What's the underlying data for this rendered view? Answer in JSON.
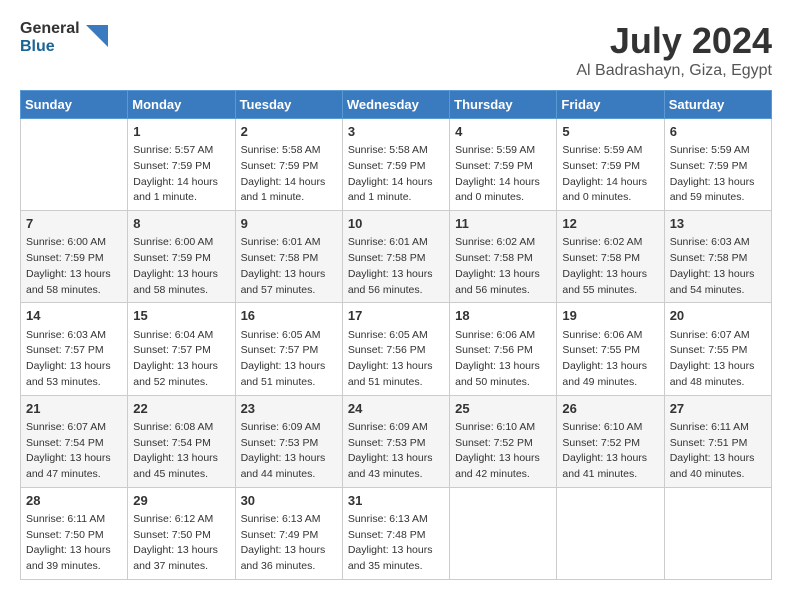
{
  "header": {
    "logo_line1": "General",
    "logo_line2": "Blue",
    "title": "July 2024",
    "subtitle": "Al Badrashayn, Giza, Egypt"
  },
  "weekdays": [
    "Sunday",
    "Monday",
    "Tuesday",
    "Wednesday",
    "Thursday",
    "Friday",
    "Saturday"
  ],
  "weeks": [
    [
      {
        "date": "",
        "content": ""
      },
      {
        "date": "1",
        "content": "Sunrise: 5:57 AM\nSunset: 7:59 PM\nDaylight: 14 hours\nand 1 minute."
      },
      {
        "date": "2",
        "content": "Sunrise: 5:58 AM\nSunset: 7:59 PM\nDaylight: 14 hours\nand 1 minute."
      },
      {
        "date": "3",
        "content": "Sunrise: 5:58 AM\nSunset: 7:59 PM\nDaylight: 14 hours\nand 1 minute."
      },
      {
        "date": "4",
        "content": "Sunrise: 5:59 AM\nSunset: 7:59 PM\nDaylight: 14 hours\nand 0 minutes."
      },
      {
        "date": "5",
        "content": "Sunrise: 5:59 AM\nSunset: 7:59 PM\nDaylight: 14 hours\nand 0 minutes."
      },
      {
        "date": "6",
        "content": "Sunrise: 5:59 AM\nSunset: 7:59 PM\nDaylight: 13 hours\nand 59 minutes."
      }
    ],
    [
      {
        "date": "7",
        "content": "Sunrise: 6:00 AM\nSunset: 7:59 PM\nDaylight: 13 hours\nand 58 minutes."
      },
      {
        "date": "8",
        "content": "Sunrise: 6:00 AM\nSunset: 7:59 PM\nDaylight: 13 hours\nand 58 minutes."
      },
      {
        "date": "9",
        "content": "Sunrise: 6:01 AM\nSunset: 7:58 PM\nDaylight: 13 hours\nand 57 minutes."
      },
      {
        "date": "10",
        "content": "Sunrise: 6:01 AM\nSunset: 7:58 PM\nDaylight: 13 hours\nand 56 minutes."
      },
      {
        "date": "11",
        "content": "Sunrise: 6:02 AM\nSunset: 7:58 PM\nDaylight: 13 hours\nand 56 minutes."
      },
      {
        "date": "12",
        "content": "Sunrise: 6:02 AM\nSunset: 7:58 PM\nDaylight: 13 hours\nand 55 minutes."
      },
      {
        "date": "13",
        "content": "Sunrise: 6:03 AM\nSunset: 7:58 PM\nDaylight: 13 hours\nand 54 minutes."
      }
    ],
    [
      {
        "date": "14",
        "content": "Sunrise: 6:03 AM\nSunset: 7:57 PM\nDaylight: 13 hours\nand 53 minutes."
      },
      {
        "date": "15",
        "content": "Sunrise: 6:04 AM\nSunset: 7:57 PM\nDaylight: 13 hours\nand 52 minutes."
      },
      {
        "date": "16",
        "content": "Sunrise: 6:05 AM\nSunset: 7:57 PM\nDaylight: 13 hours\nand 51 minutes."
      },
      {
        "date": "17",
        "content": "Sunrise: 6:05 AM\nSunset: 7:56 PM\nDaylight: 13 hours\nand 51 minutes."
      },
      {
        "date": "18",
        "content": "Sunrise: 6:06 AM\nSunset: 7:56 PM\nDaylight: 13 hours\nand 50 minutes."
      },
      {
        "date": "19",
        "content": "Sunrise: 6:06 AM\nSunset: 7:55 PM\nDaylight: 13 hours\nand 49 minutes."
      },
      {
        "date": "20",
        "content": "Sunrise: 6:07 AM\nSunset: 7:55 PM\nDaylight: 13 hours\nand 48 minutes."
      }
    ],
    [
      {
        "date": "21",
        "content": "Sunrise: 6:07 AM\nSunset: 7:54 PM\nDaylight: 13 hours\nand 47 minutes."
      },
      {
        "date": "22",
        "content": "Sunrise: 6:08 AM\nSunset: 7:54 PM\nDaylight: 13 hours\nand 45 minutes."
      },
      {
        "date": "23",
        "content": "Sunrise: 6:09 AM\nSunset: 7:53 PM\nDaylight: 13 hours\nand 44 minutes."
      },
      {
        "date": "24",
        "content": "Sunrise: 6:09 AM\nSunset: 7:53 PM\nDaylight: 13 hours\nand 43 minutes."
      },
      {
        "date": "25",
        "content": "Sunrise: 6:10 AM\nSunset: 7:52 PM\nDaylight: 13 hours\nand 42 minutes."
      },
      {
        "date": "26",
        "content": "Sunrise: 6:10 AM\nSunset: 7:52 PM\nDaylight: 13 hours\nand 41 minutes."
      },
      {
        "date": "27",
        "content": "Sunrise: 6:11 AM\nSunset: 7:51 PM\nDaylight: 13 hours\nand 40 minutes."
      }
    ],
    [
      {
        "date": "28",
        "content": "Sunrise: 6:11 AM\nSunset: 7:50 PM\nDaylight: 13 hours\nand 39 minutes."
      },
      {
        "date": "29",
        "content": "Sunrise: 6:12 AM\nSunset: 7:50 PM\nDaylight: 13 hours\nand 37 minutes."
      },
      {
        "date": "30",
        "content": "Sunrise: 6:13 AM\nSunset: 7:49 PM\nDaylight: 13 hours\nand 36 minutes."
      },
      {
        "date": "31",
        "content": "Sunrise: 6:13 AM\nSunset: 7:48 PM\nDaylight: 13 hours\nand 35 minutes."
      },
      {
        "date": "",
        "content": ""
      },
      {
        "date": "",
        "content": ""
      },
      {
        "date": "",
        "content": ""
      }
    ]
  ]
}
